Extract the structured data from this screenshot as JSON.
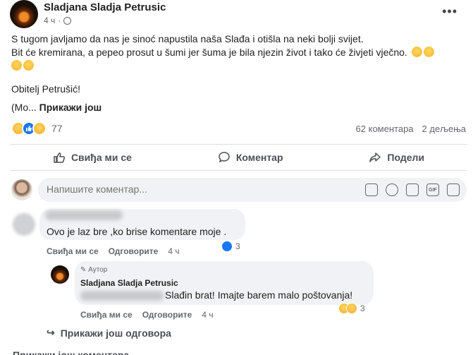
{
  "post": {
    "author": "Sladjana Sladja Petrusic",
    "time": "4 ч",
    "text_line1": "S tugom javljamo da nas je sinoć napustila naša Slađa i otišla na neki bolji svijet.",
    "text_line2": "Bit će kremirana, a pepeo prosut u šumi jer šuma je bila njezin život i tako će živjeti vječno.",
    "signature": "Obitelj Petrušić!",
    "see_more_prefix": "(Mo...",
    "see_more_label": "Прикажи још",
    "reaction_count": "77",
    "comments_count": "62 коментара",
    "shares_count": "2 дељења"
  },
  "actions": {
    "like": "Свиђа ми се",
    "comment": "Коментар",
    "share": "Подели"
  },
  "composer": {
    "placeholder": "Напишите коментар..."
  },
  "comments": [
    {
      "text": "Ovo je laz bre ,ko brise komentare moje .",
      "like_label": "Свиђа ми се",
      "reply_label": "Одговорите",
      "time": "4 ч",
      "reaction_count": "3"
    }
  ],
  "reply": {
    "author_tag": "Аутор",
    "name": "Sladjana Sladja Petrusic",
    "text": "Slađin brat! Imajte barem malo poštovanja!",
    "like_label": "Свиђа ми се",
    "reply_label": "Одговорите",
    "time": "4 ч",
    "reaction_count": "3"
  },
  "more_replies": "Прикажи још одговора",
  "more_comments": "Прикажи још коментара",
  "icons": [
    "globe-icon",
    "more-icon",
    "like-icon",
    "comment-icon",
    "share-icon",
    "emoji-icon",
    "camera-icon",
    "gif-icon",
    "sticker-icon",
    "reply-arrow-icon",
    "pencil-icon"
  ],
  "colors": {
    "like_blue": "#1877f2",
    "gray_text": "#65676b",
    "bubble_bg": "#f0f2f5"
  }
}
